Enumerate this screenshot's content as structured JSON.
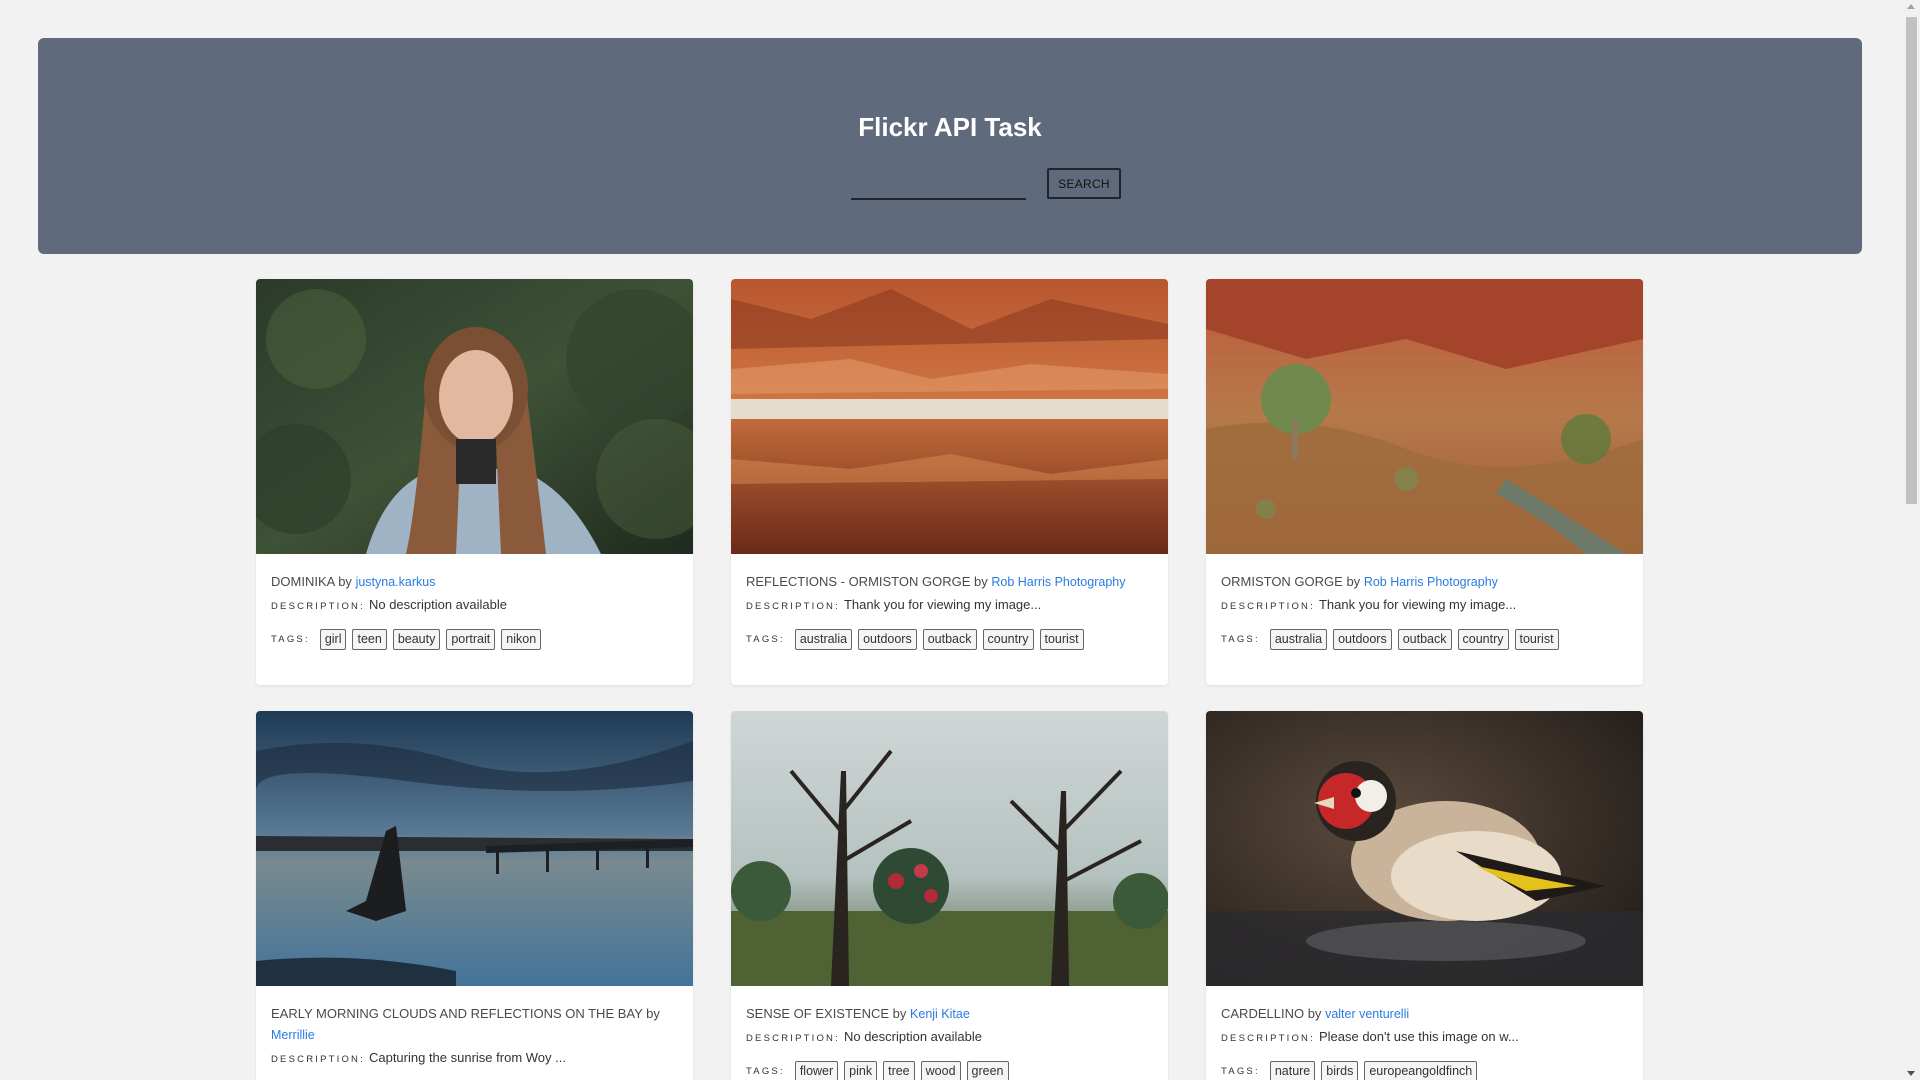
{
  "header": {
    "title": "Flickr API Task",
    "search_value": "",
    "search_button_label": "SEARCH",
    "background_color": "#5f6b7c"
  },
  "labels": {
    "by": "by",
    "description": "Description:",
    "tags": "Tags:"
  },
  "cards": [
    {
      "title": "DOMINIKA",
      "author": "justyna.karkus",
      "description": "No description available",
      "tags": [
        "girl",
        "teen",
        "beauty",
        "portrait",
        "nikon"
      ],
      "image": "portrait-photo"
    },
    {
      "title": "REFLECTIONS - ORMISTON GORGE",
      "author": "Rob Harris Photography",
      "description": "Thank you for viewing my image...",
      "tags": [
        "australia",
        "outdoors",
        "outback",
        "country",
        "tourist"
      ],
      "image": "gorge-reflection-photo"
    },
    {
      "title": "ORMISTON GORGE",
      "author": "Rob Harris Photography",
      "description": "Thank you for viewing my image...",
      "tags": [
        "australia",
        "outdoors",
        "outback",
        "country",
        "tourist"
      ],
      "image": "gorge-landscape-photo"
    },
    {
      "title": "EARLY MORNING CLOUDS AND REFLECTIONS ON THE BAY",
      "author": "Merrillie",
      "description": "Capturing the sunrise from Woy ...",
      "tags": [],
      "image": "sunrise-bay-photo"
    },
    {
      "title": "SENSE OF EXISTENCE",
      "author": "Kenji Kitae",
      "description": "No description available",
      "tags": [
        "flower",
        "pink",
        "tree",
        "wood",
        "green"
      ],
      "image": "trees-photo"
    },
    {
      "title": "CARDELLINO",
      "author": "valter venturelli",
      "description": "Please don't use this image on w...",
      "tags": [
        "nature",
        "birds",
        "europeangoldfinch"
      ],
      "image": "goldfinch-photo"
    }
  ]
}
